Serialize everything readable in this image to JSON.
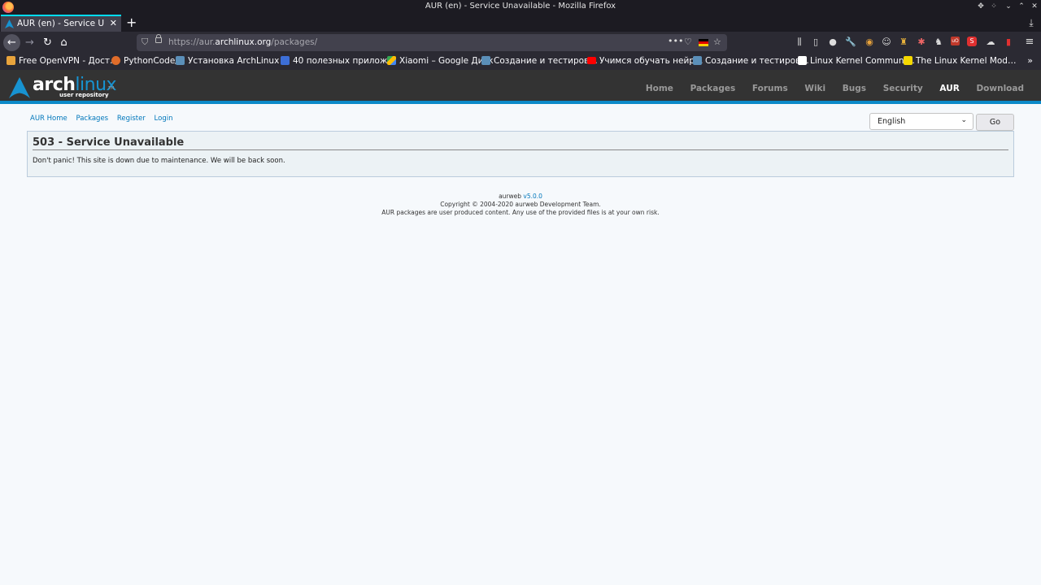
{
  "window": {
    "title": "AUR (en) - Service Unavailable - Mozilla Firefox"
  },
  "tab": {
    "label": "AUR (en) - Service Unavailable",
    "close": "✕",
    "new_tab": "+"
  },
  "navbar": {
    "url_prefix": "https://aur.",
    "url_domain": "archlinux.org",
    "url_path": "/packages/",
    "page_actions": "•••"
  },
  "bookmarks": [
    {
      "label": "Free OpenVPN - Дост…",
      "color": "#e8a33c"
    },
    {
      "label": "PythonCode/",
      "color": "#e06c2a"
    },
    {
      "label": "Установка ArchLinux …",
      "color": "#5b8fb9"
    },
    {
      "label": "40 полезных прилож…",
      "color": "#3d6fd8"
    },
    {
      "label": "Xiaomi – Google Диск",
      "color": "#34a853"
    },
    {
      "label": "Создание и тестиров…",
      "color": "#5b8fb9"
    },
    {
      "label": "Учимся обучать нейр…",
      "color": "#ff0000"
    },
    {
      "label": "Создание и тестиров…",
      "color": "#5b8fb9"
    },
    {
      "label": "Linux Kernel Communi…",
      "color": "#111111"
    },
    {
      "label": "The Linux Kernel Mod…",
      "color": "#f5d800"
    }
  ],
  "bookmarks_more": "»",
  "arch": {
    "logo_arch": "arch",
    "logo_linux": "linux",
    "logo_tm": "TM",
    "logo_sub": "user repository",
    "nav": [
      "Home",
      "Packages",
      "Forums",
      "Wiki",
      "Bugs",
      "Security",
      "AUR",
      "Download"
    ],
    "active": "AUR",
    "brand_color": "#1793d1"
  },
  "subnav": [
    "AUR Home",
    "Packages",
    "Register",
    "Login"
  ],
  "language": {
    "selected": "English",
    "go_label": "Go"
  },
  "error": {
    "title": "503 - Service Unavailable",
    "message": "Don't panic! This site is down due to maintenance. We will be back soon."
  },
  "footer": {
    "name": "aurweb",
    "version": "v5.0.0",
    "copyright": "Copyright © 2004-2020 aurweb Development Team.",
    "disclaimer": "AUR packages are user produced content. Any use of the provided files is at your own risk."
  }
}
